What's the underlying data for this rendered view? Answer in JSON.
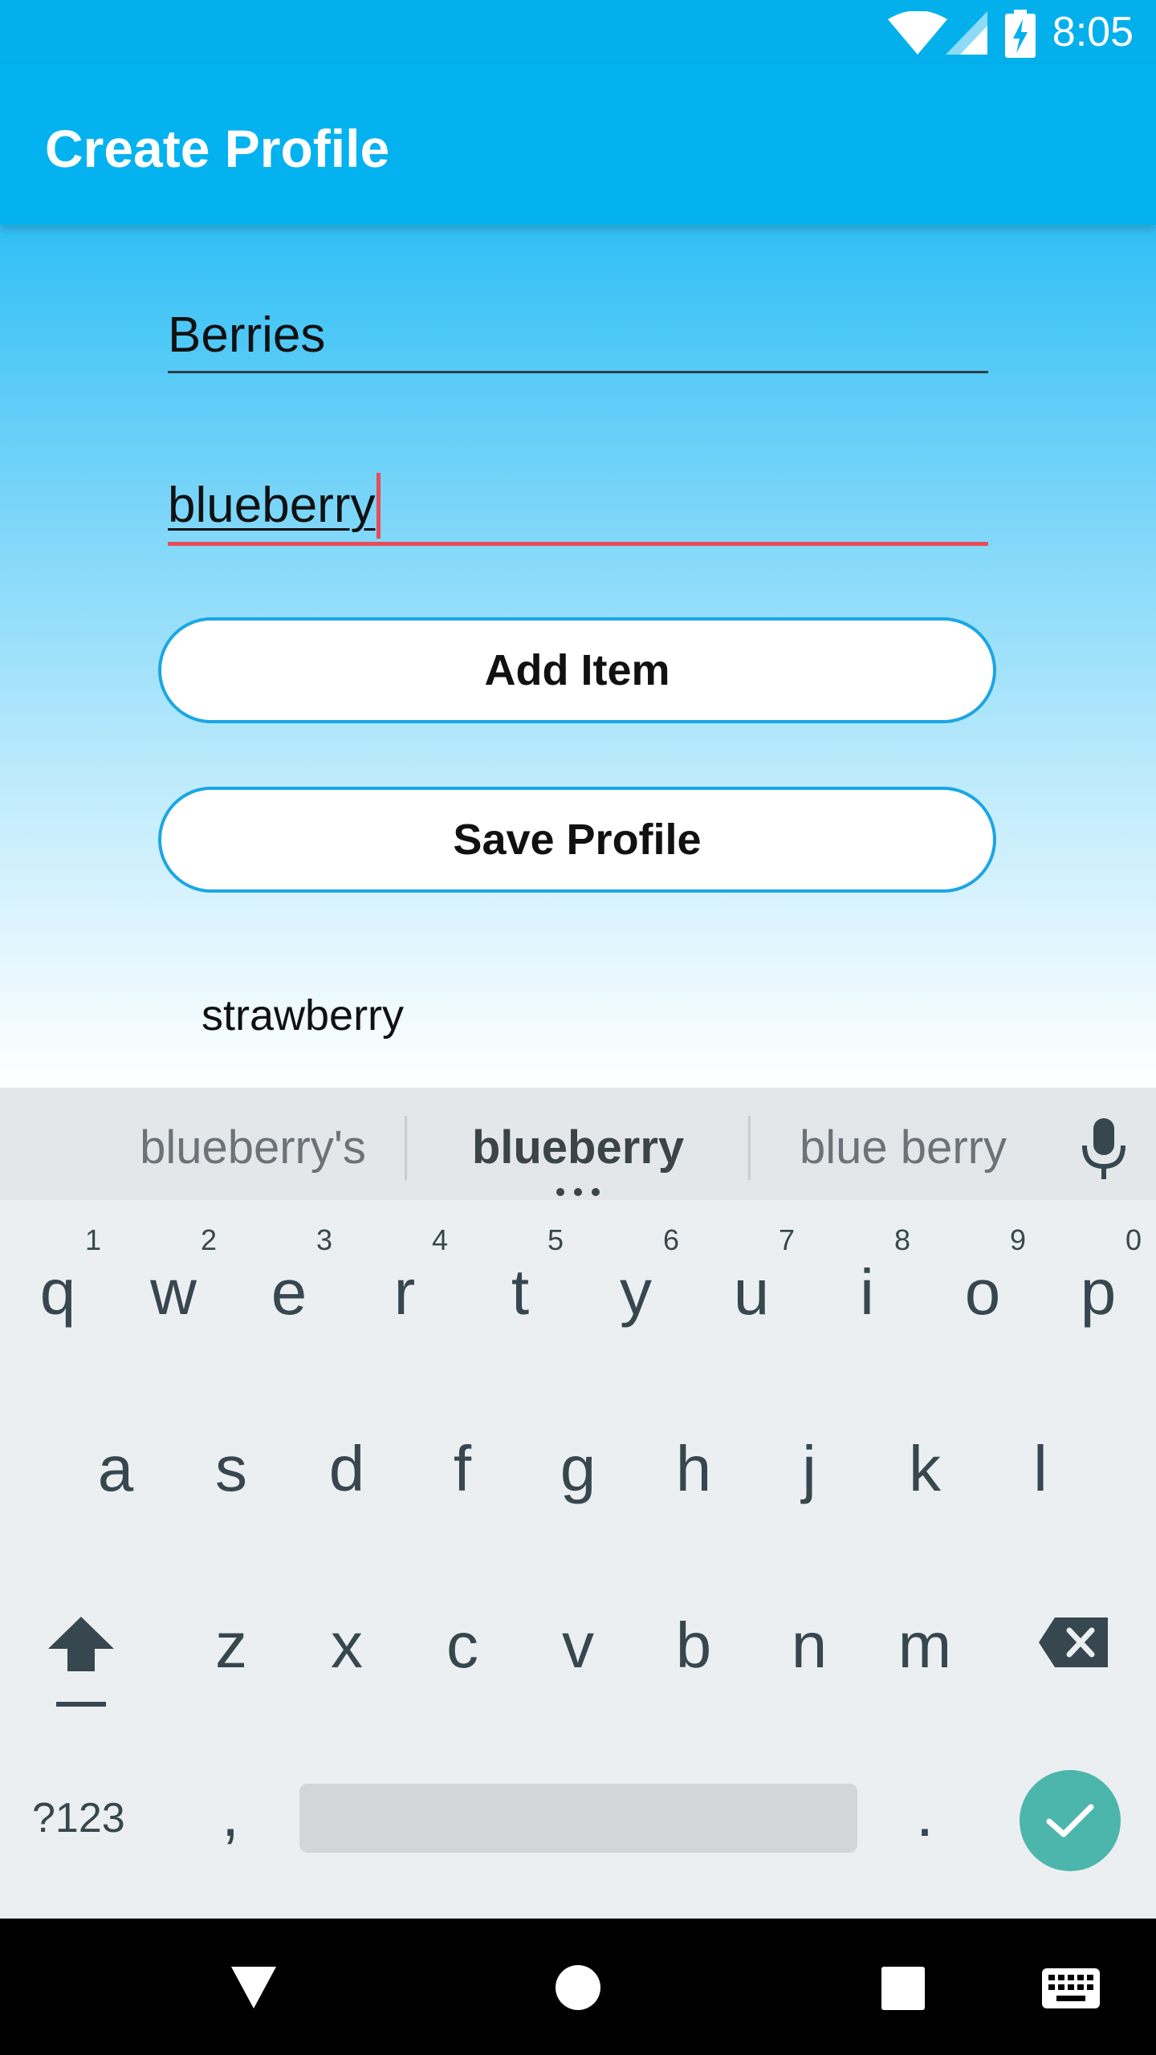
{
  "status_bar": {
    "time": "8:05",
    "icons": [
      "wifi-icon",
      "signal-icon",
      "battery-charging-icon"
    ]
  },
  "app_bar": {
    "title": "Create Profile"
  },
  "form": {
    "profile_name_value": "Berries",
    "item_value": "blueberry",
    "add_item_label": "Add Item",
    "save_profile_label": "Save Profile"
  },
  "items": [
    "strawberry"
  ],
  "keyboard": {
    "suggestions": [
      "blueberry's",
      "blueberry",
      "blue berry"
    ],
    "row1": [
      "q",
      "w",
      "e",
      "r",
      "t",
      "y",
      "u",
      "i",
      "o",
      "p"
    ],
    "row1_hints": [
      "1",
      "2",
      "3",
      "4",
      "5",
      "6",
      "7",
      "8",
      "9",
      "0"
    ],
    "row2": [
      "a",
      "s",
      "d",
      "f",
      "g",
      "h",
      "j",
      "k",
      "l"
    ],
    "row3": [
      "z",
      "x",
      "c",
      "v",
      "b",
      "n",
      "m"
    ],
    "symbols_label": "?123",
    "comma": ",",
    "period": "."
  },
  "colors": {
    "app_bar": "#04B2EF",
    "accent": "#E74C58",
    "button_border": "#1BA6E3",
    "enter_key": "#4DB6AC"
  }
}
